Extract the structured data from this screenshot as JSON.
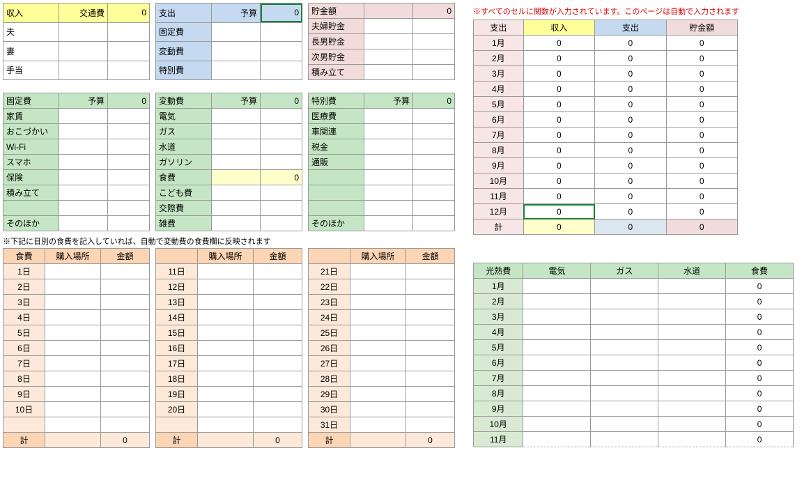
{
  "income": {
    "title": "収入",
    "col2": "交通費",
    "col2val": "0",
    "rows": [
      "夫",
      "妻",
      "手当"
    ]
  },
  "expense": {
    "title": "支出",
    "col2": "予算",
    "col2val": "0",
    "rows": [
      "固定費",
      "変動費",
      "特別費"
    ]
  },
  "savings": {
    "title": "貯金額",
    "col2": "",
    "col2val": "0",
    "rows": [
      "夫婦貯金",
      "長男貯金",
      "次男貯金",
      "積み立て"
    ]
  },
  "fixed": {
    "title": "固定費",
    "budget": "予算",
    "budgetval": "0",
    "rows": [
      "家賃",
      "おこづかい",
      "Wi-Fi",
      "スマホ",
      "保険",
      "積み立て",
      "",
      "そのほか"
    ]
  },
  "variable": {
    "title": "変動費",
    "budget": "予算",
    "budgetval": "0",
    "rows": [
      "電気",
      "ガス",
      "水道",
      "ガソリン",
      "食費",
      "こども費",
      "交際費",
      "雑費"
    ],
    "foodval": "0"
  },
  "special": {
    "title": "特別費",
    "budget": "予算",
    "budgetval": "0",
    "rows": [
      "医療費",
      "車関連",
      "税金",
      "通販",
      "",
      "",
      "",
      "そのほか"
    ]
  },
  "foodnote": "※下記に日別の食費を記入していれば、自動で変動費の食費欄に反映されます",
  "food": {
    "title": "食費",
    "place": "購入場所",
    "amount": "金額",
    "total": "計",
    "totalval": "0",
    "d1": [
      "1日",
      "2日",
      "3日",
      "4日",
      "5日",
      "6日",
      "7日",
      "8日",
      "9日",
      "10日"
    ],
    "d2": [
      "11日",
      "12日",
      "13日",
      "14日",
      "15日",
      "16日",
      "17日",
      "18日",
      "19日",
      "20日"
    ],
    "d3": [
      "21日",
      "22日",
      "23日",
      "24日",
      "25日",
      "26日",
      "27日",
      "28日",
      "29日",
      "30日",
      "31日"
    ]
  },
  "rightnote": "※すべてのセルに関数が入力されています。このページは自動で入力されます",
  "summary": {
    "h1": "支出",
    "h2": "収入",
    "h3": "支出",
    "h4": "貯金額",
    "months": [
      "1月",
      "2月",
      "3月",
      "4月",
      "5月",
      "6月",
      "7月",
      "8月",
      "9月",
      "10月",
      "11月",
      "12月"
    ],
    "total": "計",
    "z": "0"
  },
  "util": {
    "h1": "光熱費",
    "h2": "電気",
    "h3": "ガス",
    "h4": "水道",
    "h5": "食費",
    "months": [
      "1月",
      "2月",
      "3月",
      "4月",
      "5月",
      "6月",
      "7月",
      "8月",
      "9月",
      "10月",
      "11月"
    ],
    "z": "0"
  }
}
